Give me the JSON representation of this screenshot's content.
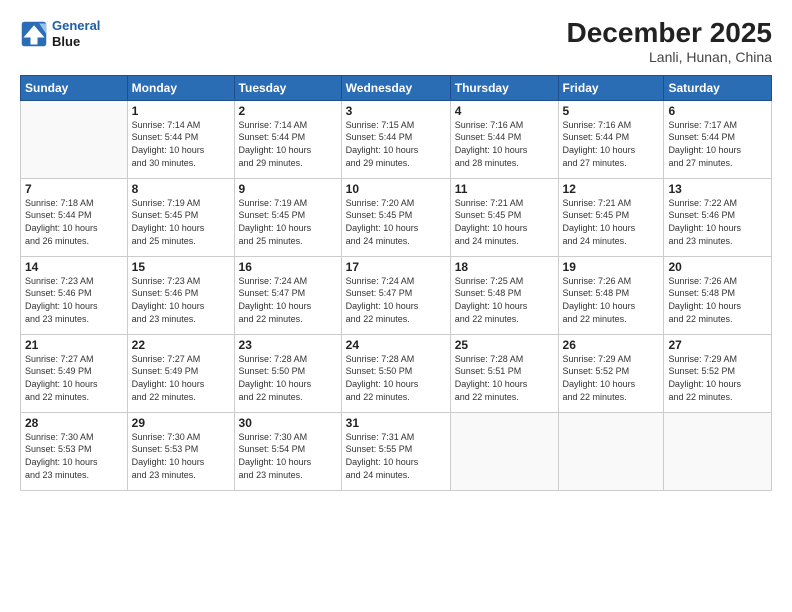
{
  "header": {
    "logo_line1": "General",
    "logo_line2": "Blue",
    "month": "December 2025",
    "location": "Lanli, Hunan, China"
  },
  "weekdays": [
    "Sunday",
    "Monday",
    "Tuesday",
    "Wednesday",
    "Thursday",
    "Friday",
    "Saturday"
  ],
  "weeks": [
    [
      {
        "day": "",
        "info": ""
      },
      {
        "day": "1",
        "info": "Sunrise: 7:14 AM\nSunset: 5:44 PM\nDaylight: 10 hours\nand 30 minutes."
      },
      {
        "day": "2",
        "info": "Sunrise: 7:14 AM\nSunset: 5:44 PM\nDaylight: 10 hours\nand 29 minutes."
      },
      {
        "day": "3",
        "info": "Sunrise: 7:15 AM\nSunset: 5:44 PM\nDaylight: 10 hours\nand 29 minutes."
      },
      {
        "day": "4",
        "info": "Sunrise: 7:16 AM\nSunset: 5:44 PM\nDaylight: 10 hours\nand 28 minutes."
      },
      {
        "day": "5",
        "info": "Sunrise: 7:16 AM\nSunset: 5:44 PM\nDaylight: 10 hours\nand 27 minutes."
      },
      {
        "day": "6",
        "info": "Sunrise: 7:17 AM\nSunset: 5:44 PM\nDaylight: 10 hours\nand 27 minutes."
      }
    ],
    [
      {
        "day": "7",
        "info": "Sunrise: 7:18 AM\nSunset: 5:44 PM\nDaylight: 10 hours\nand 26 minutes."
      },
      {
        "day": "8",
        "info": "Sunrise: 7:19 AM\nSunset: 5:45 PM\nDaylight: 10 hours\nand 25 minutes."
      },
      {
        "day": "9",
        "info": "Sunrise: 7:19 AM\nSunset: 5:45 PM\nDaylight: 10 hours\nand 25 minutes."
      },
      {
        "day": "10",
        "info": "Sunrise: 7:20 AM\nSunset: 5:45 PM\nDaylight: 10 hours\nand 24 minutes."
      },
      {
        "day": "11",
        "info": "Sunrise: 7:21 AM\nSunset: 5:45 PM\nDaylight: 10 hours\nand 24 minutes."
      },
      {
        "day": "12",
        "info": "Sunrise: 7:21 AM\nSunset: 5:45 PM\nDaylight: 10 hours\nand 24 minutes."
      },
      {
        "day": "13",
        "info": "Sunrise: 7:22 AM\nSunset: 5:46 PM\nDaylight: 10 hours\nand 23 minutes."
      }
    ],
    [
      {
        "day": "14",
        "info": "Sunrise: 7:23 AM\nSunset: 5:46 PM\nDaylight: 10 hours\nand 23 minutes."
      },
      {
        "day": "15",
        "info": "Sunrise: 7:23 AM\nSunset: 5:46 PM\nDaylight: 10 hours\nand 23 minutes."
      },
      {
        "day": "16",
        "info": "Sunrise: 7:24 AM\nSunset: 5:47 PM\nDaylight: 10 hours\nand 22 minutes."
      },
      {
        "day": "17",
        "info": "Sunrise: 7:24 AM\nSunset: 5:47 PM\nDaylight: 10 hours\nand 22 minutes."
      },
      {
        "day": "18",
        "info": "Sunrise: 7:25 AM\nSunset: 5:48 PM\nDaylight: 10 hours\nand 22 minutes."
      },
      {
        "day": "19",
        "info": "Sunrise: 7:26 AM\nSunset: 5:48 PM\nDaylight: 10 hours\nand 22 minutes."
      },
      {
        "day": "20",
        "info": "Sunrise: 7:26 AM\nSunset: 5:48 PM\nDaylight: 10 hours\nand 22 minutes."
      }
    ],
    [
      {
        "day": "21",
        "info": "Sunrise: 7:27 AM\nSunset: 5:49 PM\nDaylight: 10 hours\nand 22 minutes."
      },
      {
        "day": "22",
        "info": "Sunrise: 7:27 AM\nSunset: 5:49 PM\nDaylight: 10 hours\nand 22 minutes."
      },
      {
        "day": "23",
        "info": "Sunrise: 7:28 AM\nSunset: 5:50 PM\nDaylight: 10 hours\nand 22 minutes."
      },
      {
        "day": "24",
        "info": "Sunrise: 7:28 AM\nSunset: 5:50 PM\nDaylight: 10 hours\nand 22 minutes."
      },
      {
        "day": "25",
        "info": "Sunrise: 7:28 AM\nSunset: 5:51 PM\nDaylight: 10 hours\nand 22 minutes."
      },
      {
        "day": "26",
        "info": "Sunrise: 7:29 AM\nSunset: 5:52 PM\nDaylight: 10 hours\nand 22 minutes."
      },
      {
        "day": "27",
        "info": "Sunrise: 7:29 AM\nSunset: 5:52 PM\nDaylight: 10 hours\nand 22 minutes."
      }
    ],
    [
      {
        "day": "28",
        "info": "Sunrise: 7:30 AM\nSunset: 5:53 PM\nDaylight: 10 hours\nand 23 minutes."
      },
      {
        "day": "29",
        "info": "Sunrise: 7:30 AM\nSunset: 5:53 PM\nDaylight: 10 hours\nand 23 minutes."
      },
      {
        "day": "30",
        "info": "Sunrise: 7:30 AM\nSunset: 5:54 PM\nDaylight: 10 hours\nand 23 minutes."
      },
      {
        "day": "31",
        "info": "Sunrise: 7:31 AM\nSunset: 5:55 PM\nDaylight: 10 hours\nand 24 minutes."
      },
      {
        "day": "",
        "info": ""
      },
      {
        "day": "",
        "info": ""
      },
      {
        "day": "",
        "info": ""
      }
    ]
  ]
}
